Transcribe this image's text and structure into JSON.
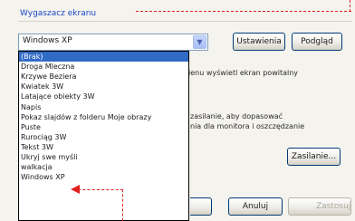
{
  "dialog": {
    "group_title": "Wygaszacz ekranu",
    "selected_screensaver": "Windows XP",
    "settings_button": "Ustawienia",
    "preview_button": "Podgląd",
    "resume_text": "ienu wyświetl ekran powitalny",
    "power_text_line1": "zasilanie, aby dopasować",
    "power_text_line2": "nia dla monitora i oszczędzanie",
    "power_button": "Zasilanie...",
    "cancel_button": "Anuluj",
    "apply_button": "Zastosuj"
  },
  "dropdown": {
    "items": [
      "(Brak)",
      "Droga Mleczna",
      "Krzywe Beziera",
      "Kwiatek 3W",
      "Latające obiekty 3W",
      "Napis",
      "Pokaz slajdów z folderu Moje obrazy",
      "Puste",
      "Rurociąg 3W",
      "Tekst 3W",
      "Ukryj swe myśli",
      "walkacja",
      "Windows XP"
    ],
    "selected_index": 0
  },
  "colors": {
    "accent": "#316ac5",
    "annotation": "#e0201c",
    "title": "#1b48c8"
  }
}
